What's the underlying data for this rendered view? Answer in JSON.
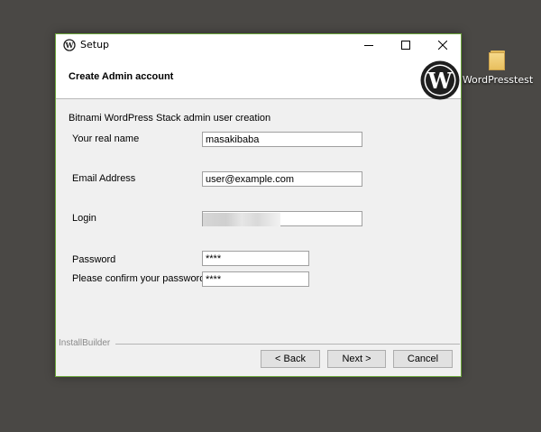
{
  "desktop": {
    "folder_label": "WordPresstest"
  },
  "window": {
    "title": "Setup",
    "header_title": "Create Admin account",
    "subtitle": "Bitnami WordPress Stack admin user creation"
  },
  "form": {
    "real_name": {
      "label": "Your real name",
      "value": "masakibaba"
    },
    "email": {
      "label": "Email Address",
      "value": "user@example.com"
    },
    "login": {
      "label": "Login",
      "value": ""
    },
    "password": {
      "label": "Password",
      "value": "****"
    },
    "confirm_password": {
      "label": "Please confirm your password",
      "value": "****"
    }
  },
  "footer": {
    "brand": "InstallBuilder",
    "back_label": "< Back",
    "next_label": "Next >",
    "cancel_label": "Cancel"
  },
  "colors": {
    "desktop_bg": "#4a4845",
    "window_border": "#6ba53a",
    "wordpress_logo": "#1e1e1e"
  }
}
